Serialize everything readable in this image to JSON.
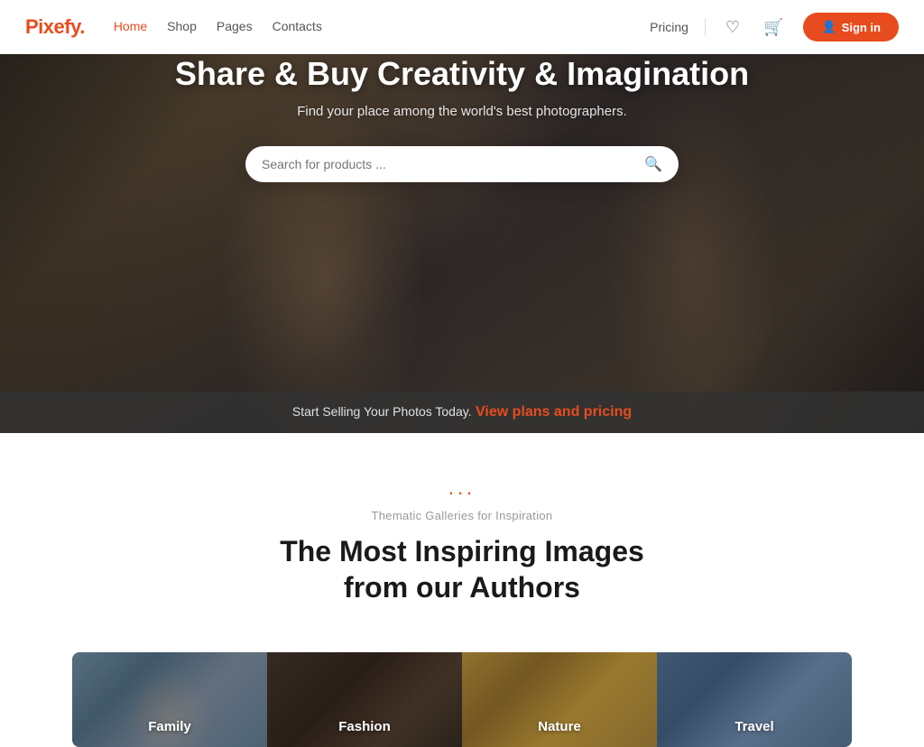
{
  "logo": {
    "text": "Pixefy",
    "dot": "."
  },
  "nav": {
    "items": [
      {
        "label": "Home",
        "active": true
      },
      {
        "label": "Shop",
        "active": false
      },
      {
        "label": "Pages",
        "active": false
      },
      {
        "label": "Contacts",
        "active": false
      }
    ]
  },
  "header": {
    "pricing_label": "Pricing",
    "signin_label": "Sign in"
  },
  "hero": {
    "title": "Share & Buy Creativity & Imagination",
    "subtitle": "Find your place among the world's best photographers.",
    "search_placeholder": "Search for products ...",
    "bottom_text": "Start Selling Your Photos Today.",
    "bottom_link": "View plans and pricing"
  },
  "section": {
    "dots": "...",
    "label": "Thematic Galleries for Inspiration",
    "title_line1": "The Most Inspiring Images",
    "title_line2": "from our Authors"
  },
  "gallery": {
    "items": [
      {
        "label": "Family",
        "bg_class": "gallery-bg-family"
      },
      {
        "label": "Fashion",
        "bg_class": "gallery-bg-fashion"
      },
      {
        "label": "Nature",
        "bg_class": "gallery-bg-nature"
      },
      {
        "label": "Travel",
        "bg_class": "gallery-bg-travel"
      }
    ]
  }
}
